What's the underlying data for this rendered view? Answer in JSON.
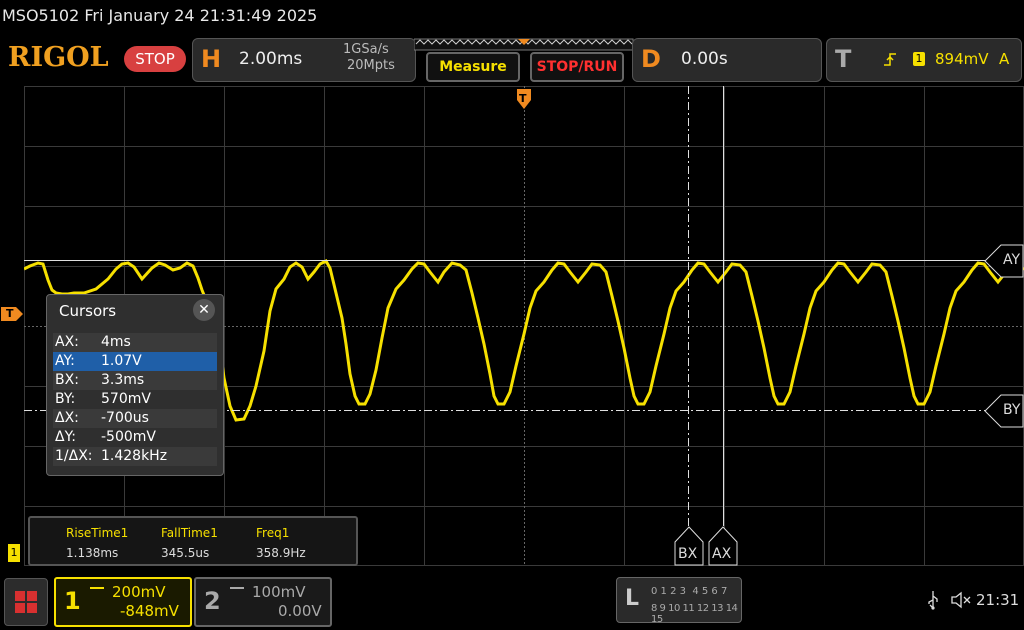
{
  "title_bar": {
    "text": "MSO5102  Fri January 24 21:31:49 2025"
  },
  "header": {
    "brand": "RIGOL",
    "run_state": "STOP",
    "horizontal": {
      "letter": "H",
      "timebase": "2.00ms",
      "sample_rate": "1GSa/s",
      "memory_depth": "20Mpts"
    },
    "measure_button": "Measure",
    "stop_run_button": "STOP/RUN",
    "delay": {
      "letter": "D",
      "value": "0.00s"
    },
    "trigger": {
      "letter": "T",
      "channel": "1",
      "level": "894mV",
      "mode": "A"
    }
  },
  "trigger_markers": {
    "top": "T",
    "left": "T"
  },
  "cursor_tags": {
    "ay": "AY",
    "by": "BY",
    "bx": "BX",
    "ax": "AX"
  },
  "cursors_panel": {
    "title": "Cursors",
    "close": "✕",
    "rows": [
      {
        "key": "AX:",
        "value": "4ms"
      },
      {
        "key": "AY:",
        "value": "1.07V"
      },
      {
        "key": "BX:",
        "value": "3.3ms"
      },
      {
        "key": "BY:",
        "value": "570mV"
      },
      {
        "key": "ΔX:",
        "value": "-700us"
      },
      {
        "key": "ΔY:",
        "value": "-500mV"
      },
      {
        "key": "1/ΔX:",
        "value": "1.428kHz"
      }
    ],
    "selected_index": 1
  },
  "measurements": [
    {
      "label": "RiseTime1",
      "value": "1.138ms"
    },
    {
      "label": "FallTime1",
      "value": "345.5us"
    },
    {
      "label": "Freq1",
      "value": "358.9Hz"
    }
  ],
  "channel_marker": "1",
  "channels": [
    {
      "number": "1",
      "scale": "200mV",
      "offset": "-848mV",
      "color": "#f6e000"
    },
    {
      "number": "2",
      "scale": "100mV",
      "offset": "0.00V",
      "color": "#aaaaaa"
    }
  ],
  "logic": {
    "letter": "L",
    "row1": "0 1 2 3  4 5 6 7",
    "row2": "8 9 10 11 12 13 14 15"
  },
  "status": {
    "usb_icon": "usb-icon",
    "sound_icon": "speaker-muted-icon",
    "clock": "21:31"
  },
  "colors": {
    "accent": "#f08a20",
    "ch1": "#f6e000",
    "stop": "#d84040",
    "selection": "#1f5fa8"
  }
}
